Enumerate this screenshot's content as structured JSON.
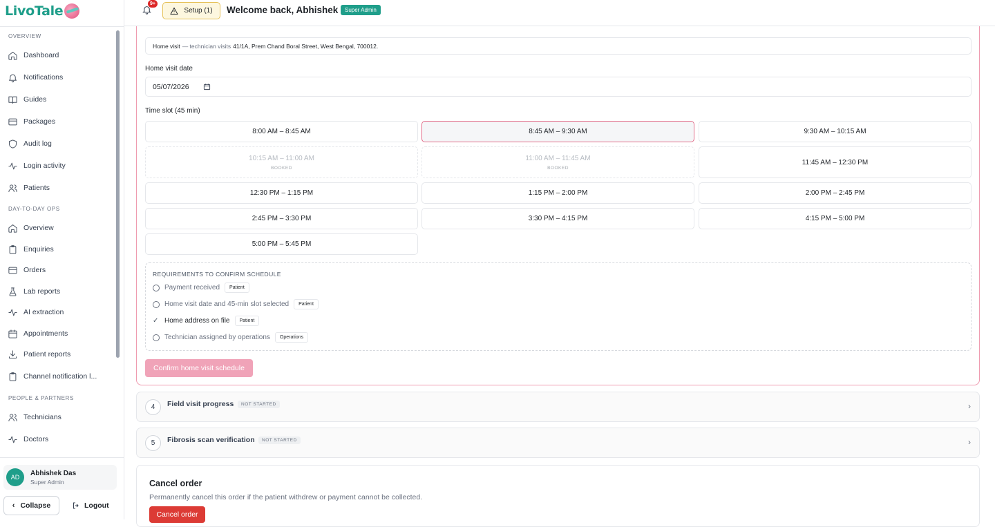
{
  "app": {
    "logo": "LivoTale"
  },
  "sidebar": {
    "sections": [
      "OVERVIEW",
      "DAY-TO-DAY OPS",
      "PEOPLE & PARTNERS"
    ],
    "items": [
      {
        "label": "Dashboard",
        "icon": "home-icon"
      },
      {
        "label": "Notifications",
        "icon": "bell-icon"
      },
      {
        "label": "Guides",
        "icon": "book-icon"
      },
      {
        "label": "Packages",
        "icon": "card-icon"
      },
      {
        "label": "Audit log",
        "icon": "shield-icon"
      },
      {
        "label": "Login activity",
        "icon": "activity-icon"
      },
      {
        "label": "Patients",
        "icon": "users-icon"
      },
      {
        "label": "Overview",
        "icon": "home-icon"
      },
      {
        "label": "Enquiries",
        "icon": "clipboard-icon"
      },
      {
        "label": "Orders",
        "icon": "card-icon"
      },
      {
        "label": "Lab reports",
        "icon": "flask-icon"
      },
      {
        "label": "AI extraction",
        "icon": "activity-icon"
      },
      {
        "label": "Appointments",
        "icon": "calendar-icon"
      },
      {
        "label": "Patient reports",
        "icon": "download-icon"
      },
      {
        "label": "Channel notification l...",
        "icon": "clipboard-icon"
      },
      {
        "label": "Technicians",
        "icon": "users-icon"
      },
      {
        "label": "Doctors",
        "icon": "activity-icon"
      }
    ],
    "user": {
      "initials": "AD",
      "name": "Abhishek Das",
      "role": "Super Admin"
    },
    "collapse_label": "Collapse",
    "logout_label": "Logout"
  },
  "topbar": {
    "notification_count": "9+",
    "setup_label": "Setup (1)",
    "welcome": "Welcome back, Abhishek",
    "role_badge": "Super Admin"
  },
  "schedule": {
    "visit_type": "Home visit",
    "visit_detail": "— technician visits",
    "address": "41/1A, Prem Chand Boral Street, West Bengal, 700012.",
    "date_label": "Home visit date",
    "date_value": "05/07/2026",
    "slot_label": "Time slot (45 min)",
    "slots": [
      {
        "label": "8:00 AM – 8:45 AM",
        "state": "available"
      },
      {
        "label": "8:45 AM – 9:30 AM",
        "state": "selected"
      },
      {
        "label": "9:30 AM – 10:15 AM",
        "state": "available"
      },
      {
        "label": "10:15 AM – 11:00 AM",
        "state": "booked",
        "note": "BOOKED"
      },
      {
        "label": "11:00 AM – 11:45 AM",
        "state": "booked",
        "note": "BOOKED"
      },
      {
        "label": "11:45 AM – 12:30 PM",
        "state": "available"
      },
      {
        "label": "12:30 PM – 1:15 PM",
        "state": "available"
      },
      {
        "label": "1:15 PM – 2:00 PM",
        "state": "available"
      },
      {
        "label": "2:00 PM – 2:45 PM",
        "state": "available"
      },
      {
        "label": "2:45 PM – 3:30 PM",
        "state": "available"
      },
      {
        "label": "3:30 PM – 4:15 PM",
        "state": "available"
      },
      {
        "label": "4:15 PM – 5:00 PM",
        "state": "available"
      },
      {
        "label": "5:00 PM – 5:45 PM",
        "state": "available"
      }
    ],
    "requirements_title": "REQUIREMENTS TO CONFIRM SCHEDULE",
    "requirements": [
      {
        "label": "Payment received",
        "tag": "Patient",
        "done": false
      },
      {
        "label": "Home visit date and 45-min slot selected",
        "tag": "Patient",
        "done": false
      },
      {
        "label": "Home address on file",
        "tag": "Patient",
        "done": true
      },
      {
        "label": "Technician assigned by operations",
        "tag": "Operations",
        "done": false
      }
    ],
    "confirm_label": "Confirm home visit schedule"
  },
  "steps": [
    {
      "num": "4",
      "title": "Field visit progress",
      "status": "NOT STARTED"
    },
    {
      "num": "5",
      "title": "Fibrosis scan verification",
      "status": "NOT STARTED"
    }
  ],
  "cancel": {
    "title": "Cancel order",
    "description": "Permanently cancel this order if the patient withdrew or payment cannot be collected.",
    "button": "Cancel order"
  },
  "colors": {
    "brand": "#1f9e8a",
    "accent": "#e26d8a",
    "danger": "#dc3b35",
    "confirm_disabled": "#f0a3b8"
  }
}
